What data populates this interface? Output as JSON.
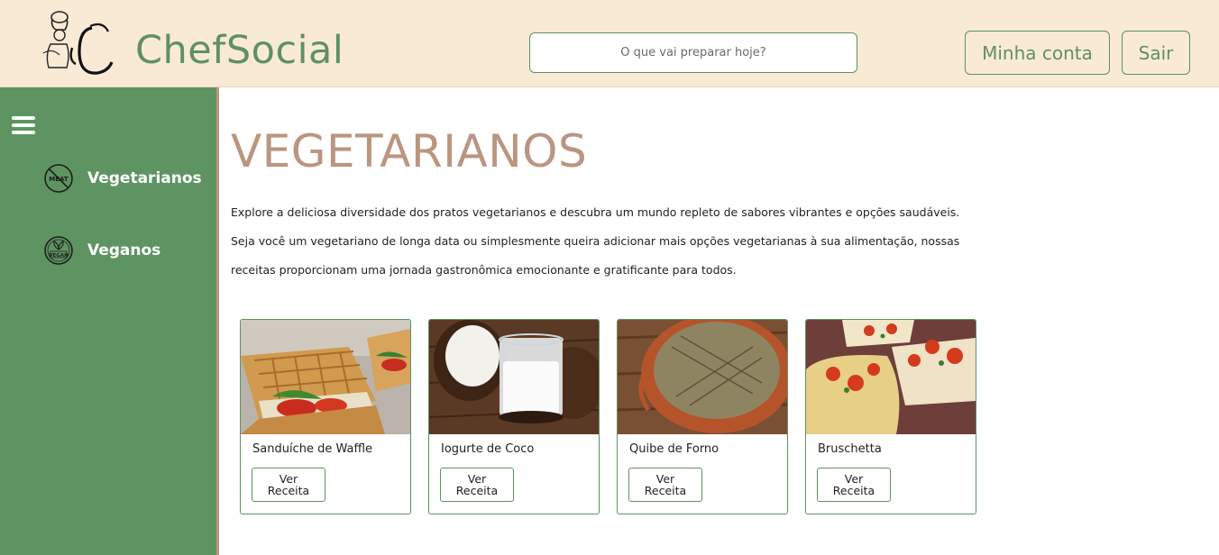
{
  "header": {
    "brand": "ChefSocial",
    "search_placeholder": "O que vai preparar hoje?",
    "account_label": "Minha conta",
    "exit_label": "Sair"
  },
  "sidebar": {
    "items": [
      {
        "label": "Vegetarianos",
        "icon": "no-meat-icon"
      },
      {
        "label": "Veganos",
        "icon": "vegan-icon"
      }
    ]
  },
  "main": {
    "title": "VEGETARIANOS",
    "description": [
      "Explore a deliciosa diversidade dos pratos vegetarianos e descubra um mundo repleto de sabores vibrantes e opções saudáveis.",
      "Seja você um vegetariano de longa data ou simplesmente queira adicionar mais opções vegetarianas à sua alimentação, nossas",
      "receitas proporcionam uma jornada gastronômica emocionante e gratificante para todos."
    ],
    "recipes": [
      {
        "name": "Sanduíche de Waffle",
        "button": "Ver Receita"
      },
      {
        "name": "Iogurte de Coco",
        "button": "Ver Receita"
      },
      {
        "name": "Quibe de Forno",
        "button": "Ver Receita"
      },
      {
        "name": "Bruschetta",
        "button": "Ver Receita"
      }
    ]
  },
  "colors": {
    "header_bg": "#f9ead6",
    "brand_green": "#5e9161",
    "sidebar_green": "#5e9461",
    "title_tan": "#bb9580"
  }
}
